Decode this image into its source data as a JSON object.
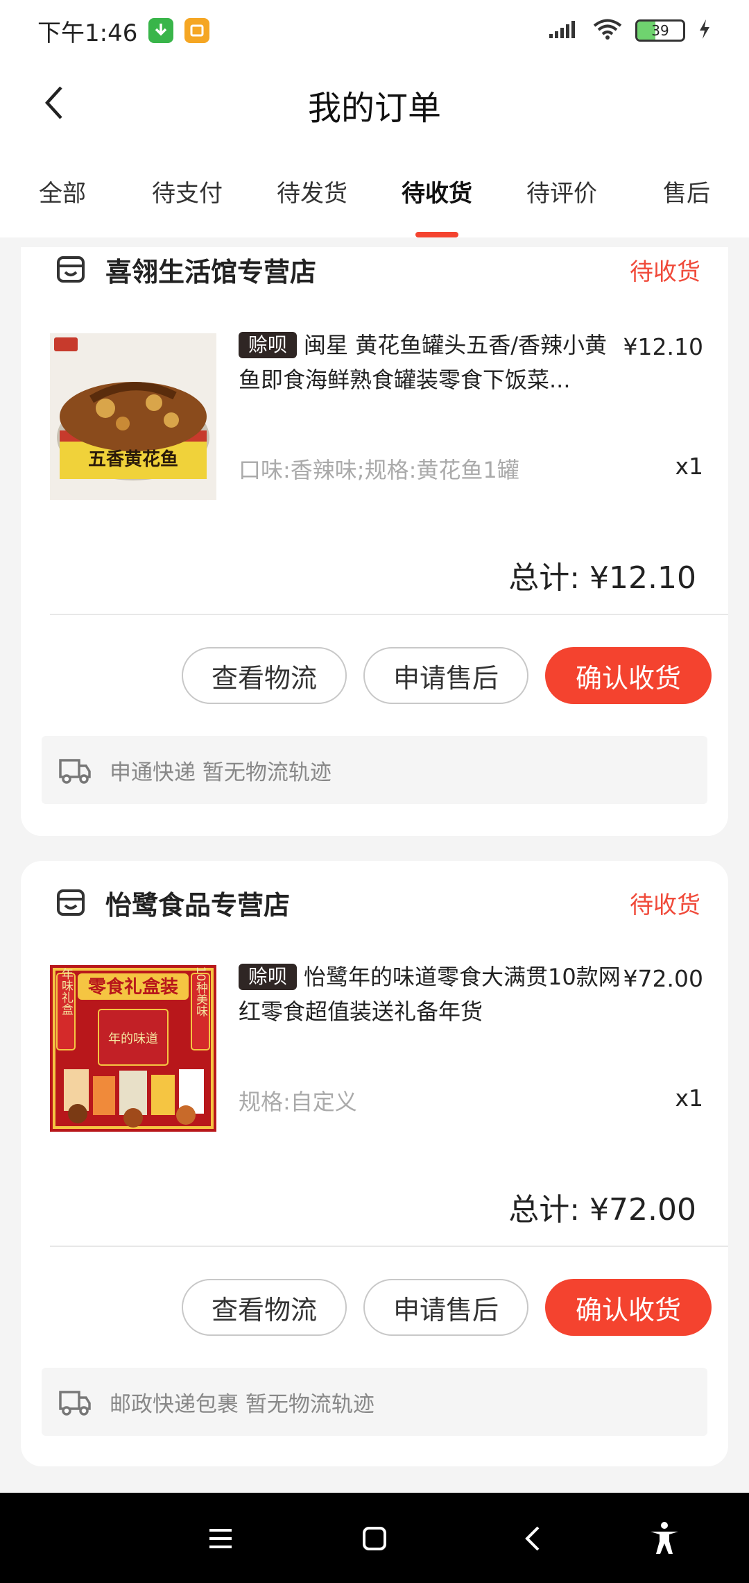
{
  "status_bar": {
    "time": "下午1:46",
    "battery": "39",
    "battery_level": 0.39,
    "app_icons": [
      "download-app-icon",
      "reader-app-icon"
    ],
    "colors": {
      "download": "#39b54a",
      "reader": "#f5a623"
    }
  },
  "header": {
    "title": "我的订单"
  },
  "tabs": [
    {
      "label": "全部",
      "active": false
    },
    {
      "label": "待支付",
      "active": false
    },
    {
      "label": "待发货",
      "active": false
    },
    {
      "label": "待收货",
      "active": true
    },
    {
      "label": "待评价",
      "active": false
    },
    {
      "label": "售后",
      "active": false
    }
  ],
  "orders": [
    {
      "store": "喜翎生活馆专营店",
      "status": "待收货",
      "product": {
        "tag": "赊呗",
        "title": "闽星 黄花鱼罐头五香/香辣小黄鱼即食海鲜熟食罐装零食下饭菜...",
        "price": "¥12.10",
        "spec": "口味:香辣味;规格:黄花鱼1罐",
        "qty": "x1",
        "image_text": "五香黄花鱼"
      },
      "total": "总计: ¥12.10",
      "buttons": {
        "logistics": "查看物流",
        "after_sale": "申请售后",
        "confirm": "确认收货"
      },
      "shipping": "申通快递  暂无物流轨迹"
    },
    {
      "store": "怡鹭食品专营店",
      "status": "待收货",
      "product": {
        "tag": "赊呗",
        "title": "怡鹭年的味道零食大满贯10款网红零食超值装送礼备年货",
        "price": "¥72.00",
        "spec": "规格:自定义",
        "qty": "x1",
        "image_text": "零食礼盒装",
        "image_side_left": "年味礼盒",
        "image_side_right": "10种美味",
        "image_box_text": "年的味道"
      },
      "total": "总计: ¥72.00",
      "buttons": {
        "logistics": "查看物流",
        "after_sale": "申请售后",
        "confirm": "确认收货"
      },
      "shipping": "邮政快递包裹  暂无物流轨迹"
    }
  ],
  "colors": {
    "accent": "#f4432f",
    "status_text": "#f04a3a",
    "tag_bg": "#2f2624"
  }
}
